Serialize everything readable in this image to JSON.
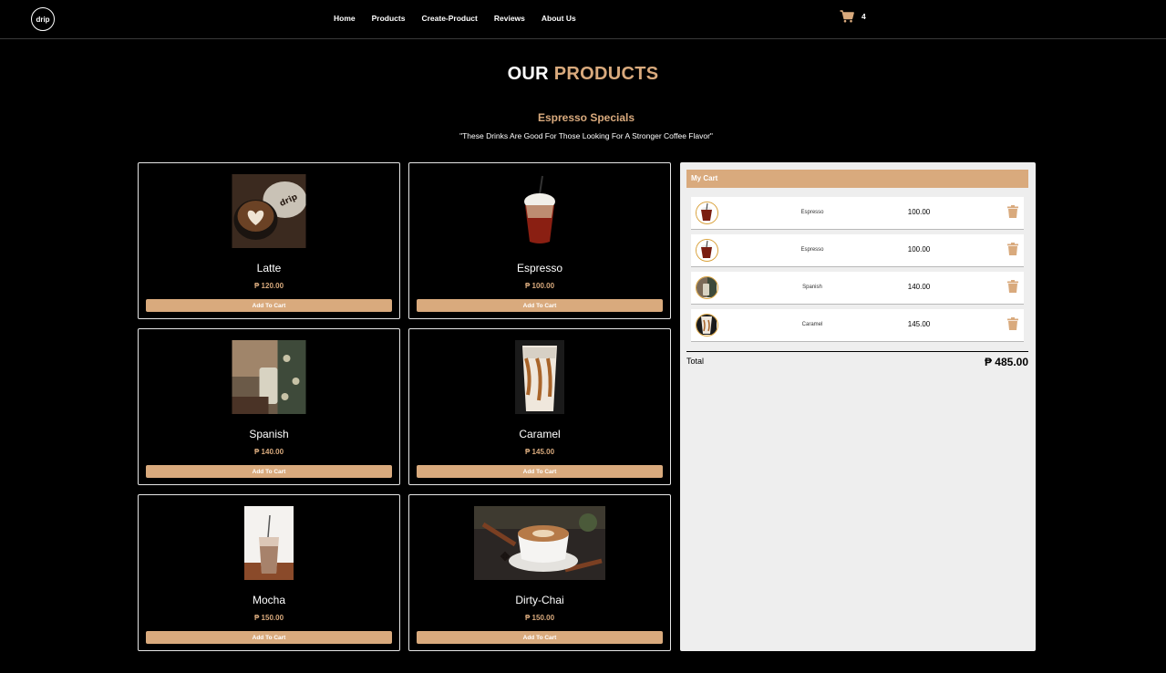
{
  "nav": {
    "logo_text": "drip",
    "links": [
      "Home",
      "Products",
      "Create-Product",
      "Reviews",
      "About Us"
    ],
    "cart_count": "4"
  },
  "page": {
    "title_main": "OUR",
    "title_accent": "PRODUCTS",
    "section_title": "Espresso Specials",
    "section_subtitle": "\"These Drinks Are Good For Those Looking For A Stronger Coffee Flavor\""
  },
  "products": [
    {
      "name": "Latte",
      "price": "₱ 120.00",
      "button": "Add To Cart"
    },
    {
      "name": "Espresso",
      "price": "₱ 100.00",
      "button": "Add To Cart"
    },
    {
      "name": "Spanish",
      "price": "₱ 140.00",
      "button": "Add To Cart"
    },
    {
      "name": "Caramel",
      "price": "₱ 145.00",
      "button": "Add To Cart"
    },
    {
      "name": "Mocha",
      "price": "₱ 150.00",
      "button": "Add To Cart"
    },
    {
      "name": "Dirty-Chai",
      "price": "₱ 150.00",
      "button": "Add To Cart"
    }
  ],
  "cart": {
    "header": "My Cart",
    "items": [
      {
        "name": "Espresso",
        "price": "100.00"
      },
      {
        "name": "Espresso",
        "price": "100.00"
      },
      {
        "name": "Spanish",
        "price": "140.00"
      },
      {
        "name": "Caramel",
        "price": "145.00"
      }
    ],
    "total_label": "Total",
    "total_value": "₱ 485.00"
  },
  "colors": {
    "accent": "#d9aa7d",
    "background": "#000000",
    "cart_panel": "#eeeeee",
    "cart_icon_ring": "#d9a13a"
  },
  "icons": {
    "cart": "shopping-cart-icon",
    "trash": "trash-icon"
  }
}
